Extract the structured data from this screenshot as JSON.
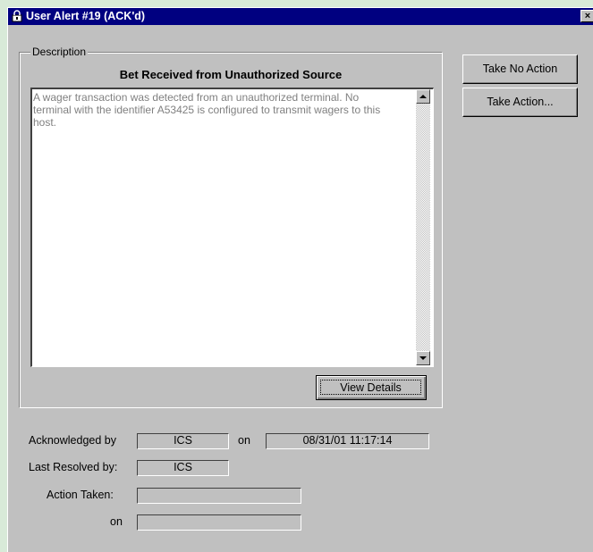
{
  "window": {
    "title": "User Alert #19 (ACK'd)",
    "close_label": "×"
  },
  "description": {
    "legend": "Description",
    "headline": "Bet Received from Unauthorized Source",
    "body": "A wager transaction was detected from an unauthorized terminal.  No terminal with the identifier A53425 is configured to transmit wagers to this host."
  },
  "buttons": {
    "view_details": "View Details",
    "take_no_action": "Take No Action",
    "take_action": "Take Action..."
  },
  "status": {
    "acknowledged_by_label": "Acknowledged by",
    "acknowledged_by": "ICS",
    "on_label": "on",
    "acknowledged_on": "08/31/01 11:17:14",
    "last_resolved_label": "Last Resolved by:",
    "last_resolved_by": "ICS",
    "action_taken_label": "Action Taken:",
    "action_taken": "",
    "action_on_label": "on",
    "action_on": ""
  },
  "icons": {
    "title_icon": "lock-icon",
    "scroll_up": "arrow-up-icon",
    "scroll_down": "arrow-down-icon"
  }
}
